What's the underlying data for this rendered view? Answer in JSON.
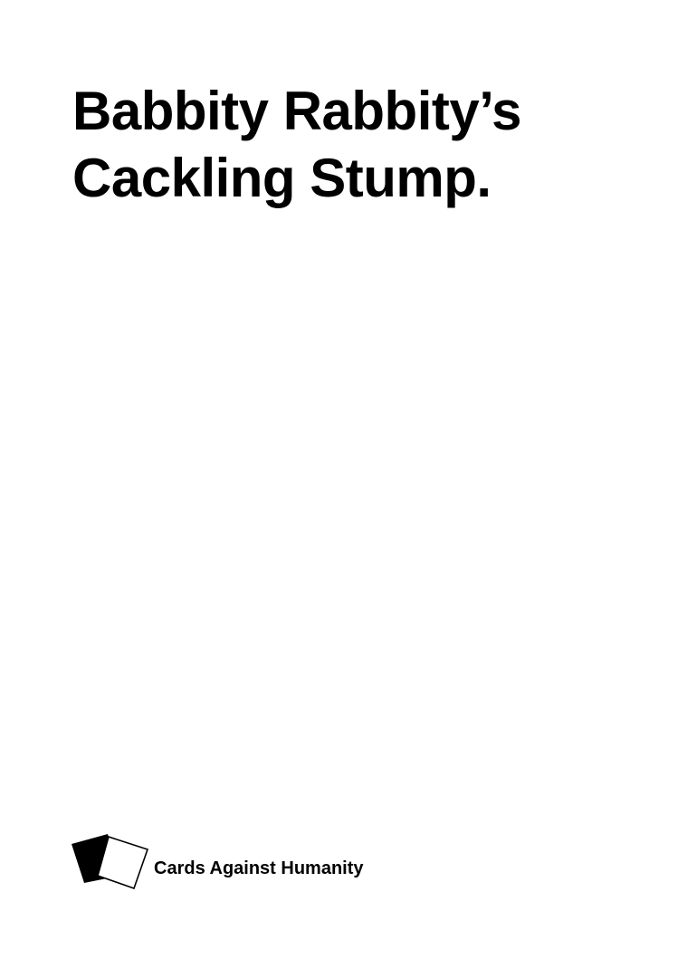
{
  "card": {
    "lines": [
      "Babbity Rabbity’s",
      "Cackling Stump."
    ]
  },
  "footer": {
    "brand": "Cards Against Humanity",
    "logo_icon": "cards-logo-icon"
  },
  "colors": {
    "background": "#ffffff",
    "text": "#000000"
  }
}
